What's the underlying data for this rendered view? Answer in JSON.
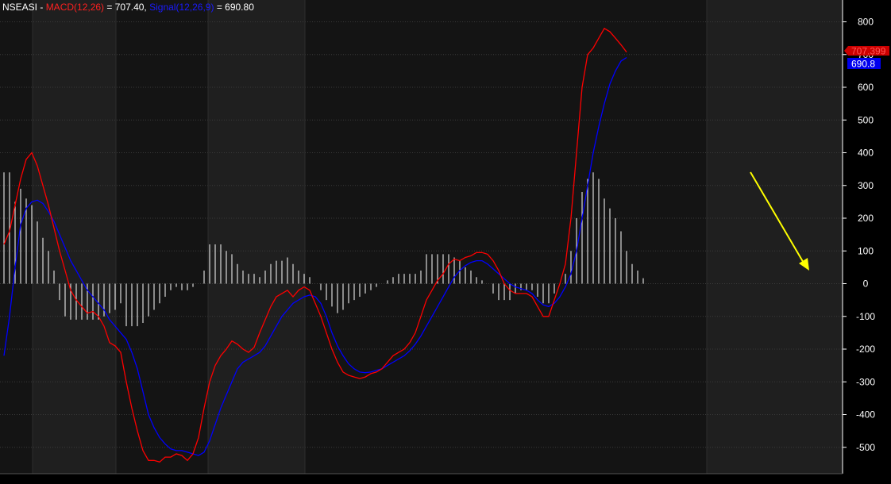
{
  "header": {
    "symbol": "NSEASI",
    "sep": " - ",
    "macd_label": "MACD(12,26)",
    "macd_eq": " = 707.40, ",
    "signal_label": "Signal(12,26,9)",
    "signal_eq": " = 690.80"
  },
  "last_values": {
    "macd": "707.399",
    "signal": "690.8"
  },
  "colors": {
    "macd": "#ff0000",
    "signal": "#0000ff",
    "histogram": "#ffffff",
    "annotation_arrow": "#ffff00",
    "background_dark": "#141414",
    "background_light": "#1f1f1f"
  },
  "chart_data": {
    "type": "line",
    "ylim": [
      -580,
      850
    ],
    "yticks": [
      800,
      700,
      600,
      500,
      400,
      300,
      200,
      100,
      0,
      -100,
      -200,
      -300,
      -400,
      -500
    ],
    "x": [
      0,
      7,
      14,
      21,
      28,
      35,
      42,
      49,
      56,
      63,
      70,
      77,
      84,
      91,
      98,
      105,
      112,
      119,
      126,
      133,
      140,
      147,
      154,
      161,
      168,
      175,
      182,
      189,
      196,
      203,
      210,
      217,
      224,
      231,
      238,
      245,
      252,
      259,
      266,
      273,
      280,
      287,
      294,
      301,
      308,
      315,
      322,
      329,
      336,
      343,
      350,
      357,
      364,
      371,
      378,
      385,
      392,
      399,
      406,
      413,
      420,
      427,
      434,
      441,
      448,
      455,
      462,
      469,
      476,
      483,
      490,
      497,
      504,
      511,
      518,
      525,
      532,
      539,
      546,
      553,
      560,
      567,
      574,
      581,
      588,
      595,
      602,
      609,
      616,
      623,
      630,
      637,
      644,
      651,
      658,
      665,
      672,
      679,
      686,
      693,
      700,
      707,
      714,
      721,
      728,
      735,
      742,
      749,
      756,
      763,
      770,
      777,
      784,
      791,
      798,
      805,
      812,
      819,
      826,
      833,
      840,
      847,
      854,
      861,
      868,
      875,
      882,
      889,
      896,
      903,
      910,
      917,
      924,
      931,
      938,
      945,
      952,
      959,
      966,
      973,
      980,
      987,
      994
    ],
    "series": [
      {
        "name": "MACD(12,26)",
        "values": [
          120,
          160,
          240,
          320,
          380,
          400,
          360,
          300,
          240,
          170,
          100,
          40,
          -20,
          -50,
          -70,
          -90,
          -85,
          -100,
          -130,
          -180,
          -190,
          -210,
          -300,
          -380,
          -450,
          -510,
          -540,
          -540,
          -545,
          -530,
          -530,
          -520,
          -525,
          -540,
          -520,
          -470,
          -380,
          -300,
          -250,
          -220,
          -200,
          -175,
          -185,
          -200,
          -210,
          -195,
          -150,
          -110,
          -70,
          -40,
          -30,
          -20,
          -40,
          -20,
          -10,
          -20,
          -60,
          -100,
          -150,
          -200,
          -240,
          -270,
          -280,
          -285,
          -290,
          -285,
          -275,
          -270,
          -260,
          -240,
          -220,
          -210,
          -200,
          -180,
          -150,
          -100,
          -50,
          -20,
          10,
          30,
          60,
          75,
          70,
          80,
          85,
          95,
          95,
          90,
          70,
          40,
          0,
          -20,
          -30,
          -30,
          -30,
          -40,
          -70,
          -100,
          -100,
          -50,
          0,
          60,
          200,
          400,
          600,
          700,
          720,
          750,
          780,
          770,
          750,
          730,
          707.4
        ]
      },
      {
        "name": "Signal(12,26,9)",
        "values": [
          -220,
          -100,
          50,
          180,
          230,
          250,
          255,
          245,
          220,
          190,
          150,
          110,
          70,
          40,
          10,
          -20,
          -40,
          -60,
          -80,
          -110,
          -130,
          -150,
          -170,
          -210,
          -260,
          -330,
          -400,
          -440,
          -470,
          -490,
          -505,
          -510,
          -510,
          -515,
          -520,
          -525,
          -515,
          -480,
          -430,
          -380,
          -340,
          -300,
          -260,
          -240,
          -230,
          -220,
          -210,
          -190,
          -160,
          -130,
          -100,
          -80,
          -60,
          -50,
          -40,
          -35,
          -40,
          -60,
          -100,
          -150,
          -190,
          -220,
          -245,
          -260,
          -270,
          -272,
          -270,
          -265,
          -260,
          -250,
          -240,
          -230,
          -220,
          -205,
          -185,
          -160,
          -130,
          -100,
          -70,
          -40,
          -10,
          20,
          40,
          55,
          65,
          70,
          70,
          60,
          45,
          30,
          15,
          0,
          -10,
          -15,
          -20,
          -30,
          -50,
          -65,
          -70,
          -60,
          -40,
          -10,
          30,
          100,
          200,
          300,
          400,
          480,
          550,
          610,
          650,
          680,
          690.8
        ]
      },
      {
        "name": "Histogram",
        "values": [
          340,
          340,
          250,
          290,
          260,
          240,
          190,
          140,
          100,
          40,
          -50,
          -100,
          -110,
          -110,
          -110,
          -110,
          -110,
          -110,
          -100,
          -90,
          -80,
          -60,
          -130,
          -130,
          -130,
          -120,
          -100,
          -80,
          -60,
          -40,
          -20,
          -10,
          -20,
          -20,
          -10,
          0,
          40,
          120,
          120,
          120,
          100,
          90,
          60,
          40,
          30,
          30,
          20,
          40,
          60,
          70,
          70,
          80,
          60,
          40,
          30,
          20,
          0,
          -20,
          -50,
          -70,
          -90,
          -80,
          -60,
          -50,
          -40,
          -30,
          -20,
          -10,
          0,
          10,
          20,
          30,
          30,
          30,
          30,
          40,
          90,
          90,
          90,
          90,
          90,
          80,
          70,
          50,
          40,
          20,
          10,
          0,
          -30,
          -50,
          -50,
          -50,
          -30,
          -20,
          -20,
          -20,
          -40,
          -60,
          -60,
          -30,
          0,
          30,
          100,
          200,
          280,
          320,
          340,
          320,
          260,
          230,
          200,
          160,
          100,
          60,
          40,
          16.6
        ]
      }
    ]
  }
}
